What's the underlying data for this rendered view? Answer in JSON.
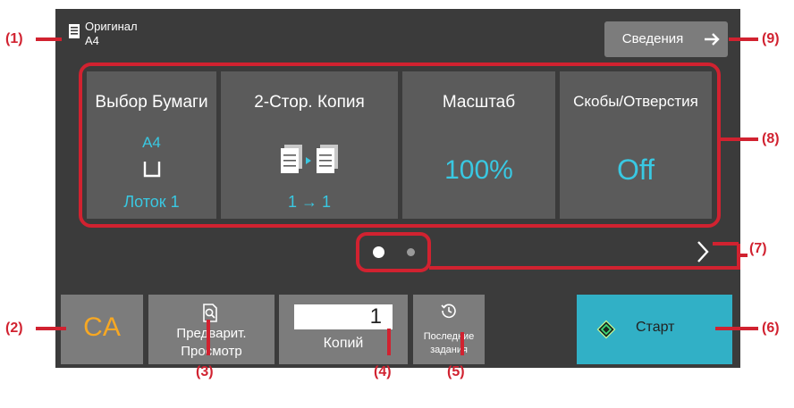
{
  "original": {
    "label": "Оригинал",
    "size": "A4",
    "icon": "original-document-icon"
  },
  "info_button": {
    "label": "Сведения",
    "icon": "arrow-right-icon"
  },
  "function_tiles": [
    {
      "title": "Выбор Бумаги",
      "value": "A4",
      "icon": "paper-tray-icon",
      "detail": "Лоток 1"
    },
    {
      "title": "2-Стор. Копия",
      "icon": "duplex-copy-icon",
      "detail": "1 → 1"
    },
    {
      "title": "Масштаб",
      "value": "100%"
    },
    {
      "title": "Скобы/Отверстия",
      "value": "Off"
    }
  ],
  "pager": {
    "icon": "chevron-right-icon",
    "pages": 2,
    "current": 1
  },
  "buttons": {
    "ca": "CA",
    "preview_line1": "Предварит.",
    "preview_line2": "Просмотр",
    "preview_icon": "preview-magnifier-icon",
    "copies_value": "1",
    "copies_label": "Копий",
    "recent_line1": "Последние",
    "recent_line2": "задания",
    "recent_icon": "history-icon",
    "start_label": "Старт",
    "start_icon": "start-diamond-icon"
  },
  "callouts": [
    "(1)",
    "(2)",
    "(3)",
    "(4)",
    "(5)",
    "(6)",
    "(7)",
    "(8)",
    "(9)"
  ],
  "colors": {
    "panel": "#3b3b3b",
    "tile": "#5b5b5b",
    "button": "#7c7c7c",
    "accent_blue": "#39c8e2",
    "ca_orange": "#f7a823",
    "start_teal": "#31b0c6",
    "callout_red": "#d12230"
  }
}
